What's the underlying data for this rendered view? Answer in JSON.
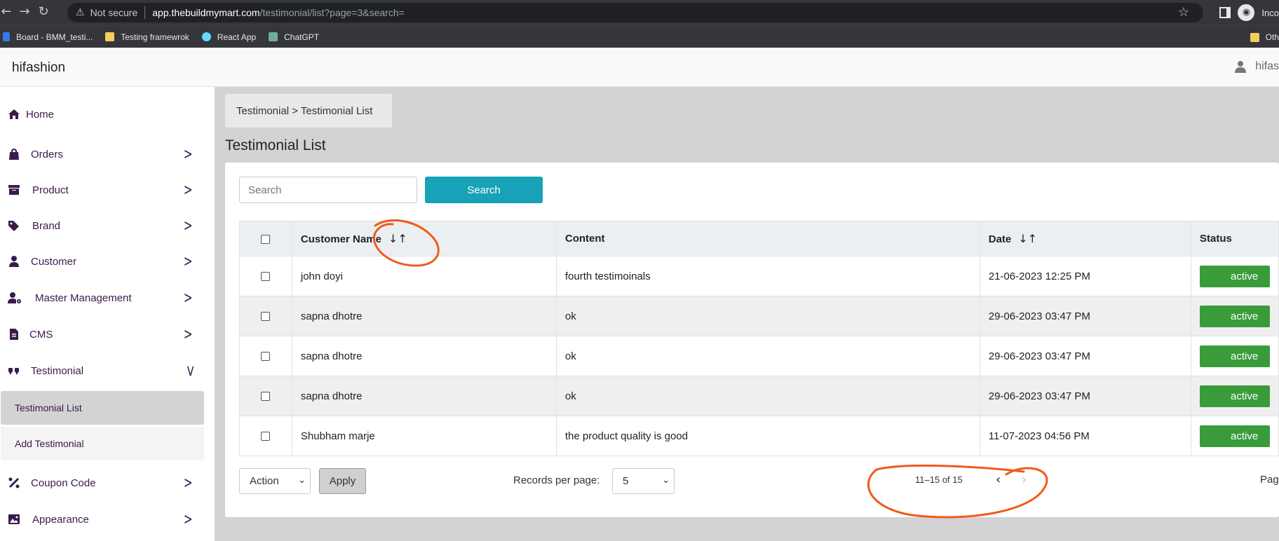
{
  "browser": {
    "not_secure": "Not secure",
    "url_host": "app.thebuildmymart.com",
    "url_path": "/testimonial/list?page=3&search=",
    "profile_label": "Inco",
    "bookmarks": [
      {
        "label": "Board - BMM_testi...",
        "color": "#2f7de1"
      },
      {
        "label": "Testing framewrok",
        "color": "#f2cf5b"
      },
      {
        "label": "React App",
        "color": "#61dafb"
      },
      {
        "label": "ChatGPT",
        "color": "#74aa9c"
      }
    ],
    "other_bookmarks": "Oth"
  },
  "header": {
    "brand": "hifashion",
    "user": "hifas"
  },
  "sidebar": {
    "items": [
      {
        "label": "Home",
        "icon": "home-icon"
      },
      {
        "label": "Orders",
        "icon": "bag-icon"
      },
      {
        "label": "Product",
        "icon": "archive-icon"
      },
      {
        "label": "Brand",
        "icon": "tags-icon"
      },
      {
        "label": "Customer",
        "icon": "user-icon"
      },
      {
        "label": "Master Management",
        "icon": "user-cog-icon"
      },
      {
        "label": "CMS",
        "icon": "file-icon"
      },
      {
        "label": "Testimonial",
        "icon": "quote-icon"
      },
      {
        "label": "Coupon Code",
        "icon": "percent-icon"
      },
      {
        "label": "Appearance",
        "icon": "image-icon"
      }
    ],
    "sub_items": [
      "Testimonial List",
      "Add Testimonial"
    ]
  },
  "main": {
    "breadcrumb": "Testimonial > Testimonial List",
    "title": "Testimonial List",
    "search_placeholder": "Search",
    "search_button": "Search",
    "columns": [
      "Customer Name",
      "Content",
      "Date",
      "Status"
    ],
    "rows": [
      {
        "name": "john doyi",
        "content": "fourth testimoinals",
        "date": "21-06-2023 12:25 PM",
        "status": "active"
      },
      {
        "name": "sapna dhotre",
        "content": "ok",
        "date": "29-06-2023 03:47 PM",
        "status": "active"
      },
      {
        "name": "sapna dhotre",
        "content": "ok",
        "date": "29-06-2023 03:47 PM",
        "status": "active"
      },
      {
        "name": "sapna dhotre",
        "content": "ok",
        "date": "29-06-2023 03:47 PM",
        "status": "active"
      },
      {
        "name": "Shubham marje",
        "content": "the product quality is good",
        "date": "11-07-2023 04:56 PM",
        "status": "active"
      }
    ],
    "action_label": "Action",
    "apply_label": "Apply",
    "rpp_label": "Records per page:",
    "rpp_value": "5",
    "pagination": "11–15 of 15",
    "page_label": "Pag"
  },
  "colors": {
    "accent": "#17a2b8",
    "status_active": "#3a9b3a",
    "annotation": "#f05a1a"
  }
}
